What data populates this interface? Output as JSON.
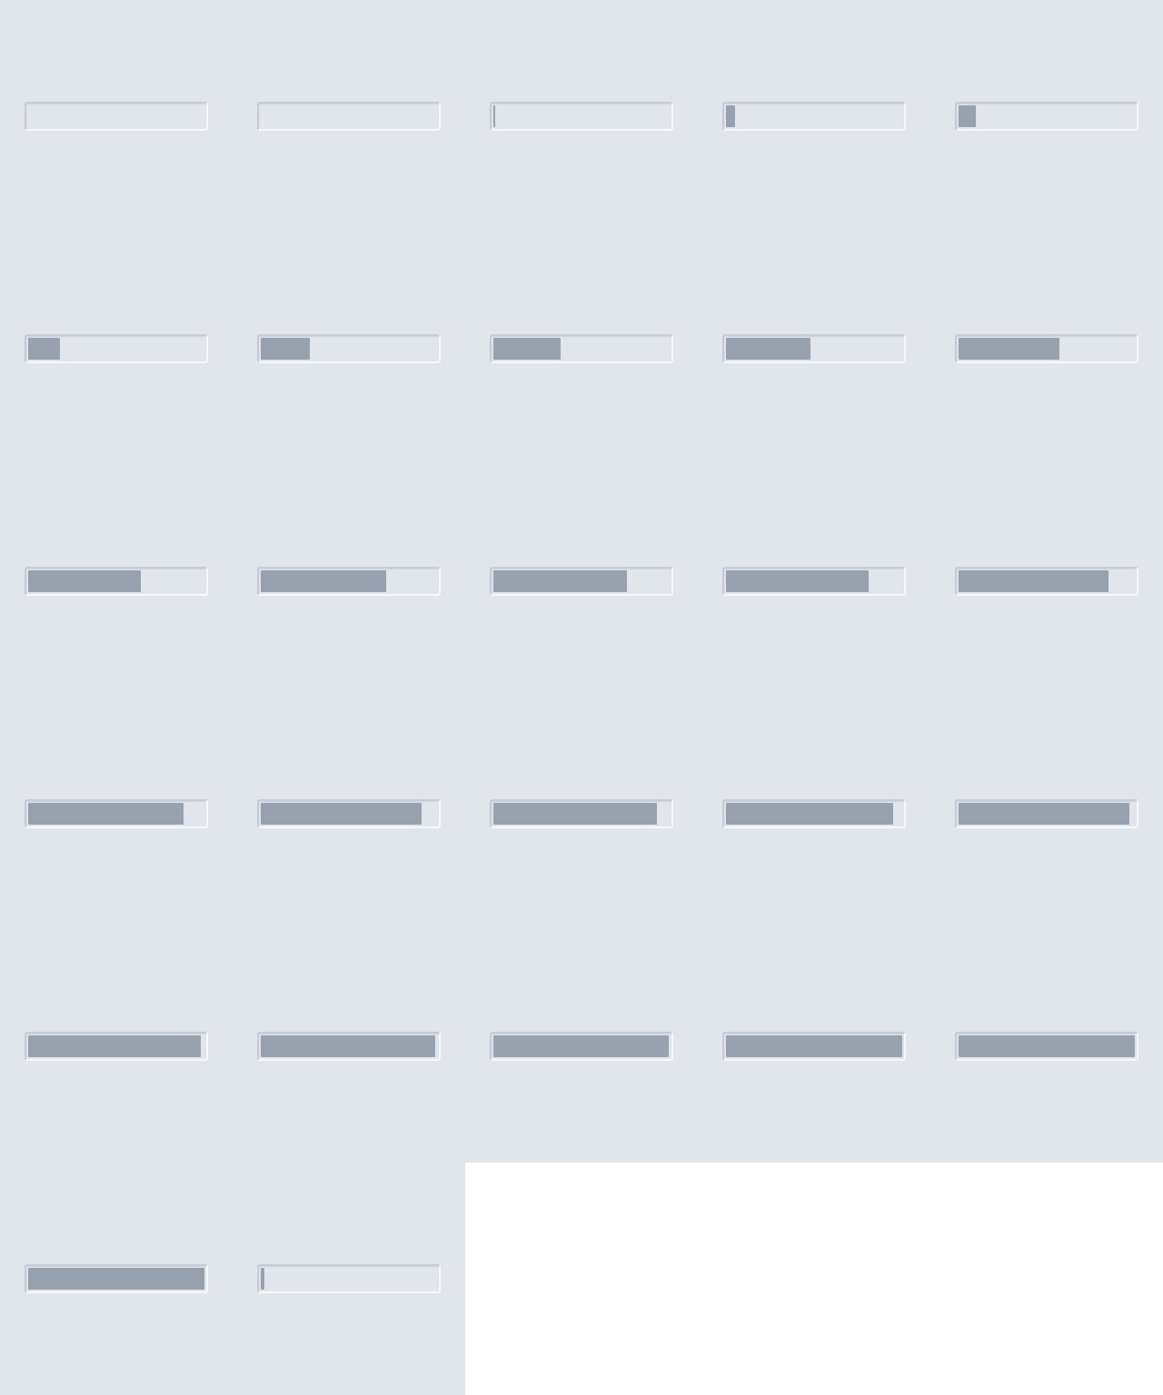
{
  "colors": {
    "background": "#e1e5ec",
    "track": "#e1e5ec",
    "fill": "#97a1b0",
    "bevel_dark": "#c5cad3",
    "bevel_light": "#f8f9fb",
    "page": "#ffffff"
  },
  "progress_bars": [
    {
      "value": 0.0
    },
    {
      "value": 0.0
    },
    {
      "value": 0.01
    },
    {
      "value": 0.05
    },
    {
      "value": 0.1
    },
    {
      "value": 0.18
    },
    {
      "value": 0.28
    },
    {
      "value": 0.38
    },
    {
      "value": 0.48
    },
    {
      "value": 0.57
    },
    {
      "value": 0.64
    },
    {
      "value": 0.71
    },
    {
      "value": 0.76
    },
    {
      "value": 0.81
    },
    {
      "value": 0.85
    },
    {
      "value": 0.88
    },
    {
      "value": 0.91
    },
    {
      "value": 0.93
    },
    {
      "value": 0.95
    },
    {
      "value": 0.97
    },
    {
      "value": 0.98
    },
    {
      "value": 0.99
    },
    {
      "value": 0.995
    },
    {
      "value": 1.0
    },
    {
      "value": 1.0
    },
    {
      "value": 1.0
    },
    {
      "value": 0.02
    }
  ]
}
